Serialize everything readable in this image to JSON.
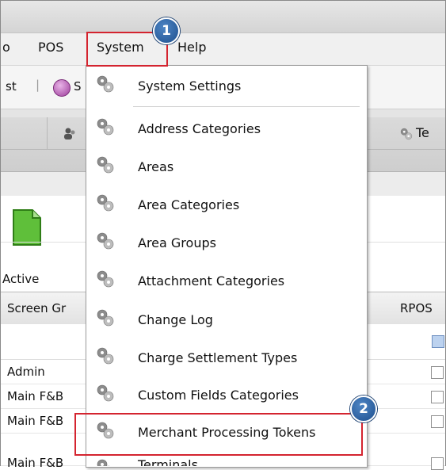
{
  "menubar": {
    "items": [
      "o",
      "POS",
      "System",
      "Help"
    ]
  },
  "toolbar": {
    "left_text": "st",
    "pipe": "|",
    "partial_label": "S"
  },
  "tabs": {
    "partial_tab_label": "Te"
  },
  "ribbon": {
    "active_label": "Active"
  },
  "grid": {
    "header_left": "Screen Gr",
    "header_right": "RPOS",
    "rows": [
      "Admin",
      "Main F&B",
      "Main F&B",
      "Main F&B"
    ]
  },
  "dropdown": {
    "items": [
      "System Settings",
      "Address Categories",
      "Areas",
      "Area Categories",
      "Area Groups",
      "Attachment Categories",
      "Change Log",
      "Charge Settlement Types",
      "Custom Fields Categories",
      "Merchant Processing Tokens",
      "Terminals"
    ]
  },
  "callouts": {
    "step1": "1",
    "step2": "2"
  },
  "colors": {
    "highlight": "#d4242f",
    "badge": "#2a62a6"
  }
}
